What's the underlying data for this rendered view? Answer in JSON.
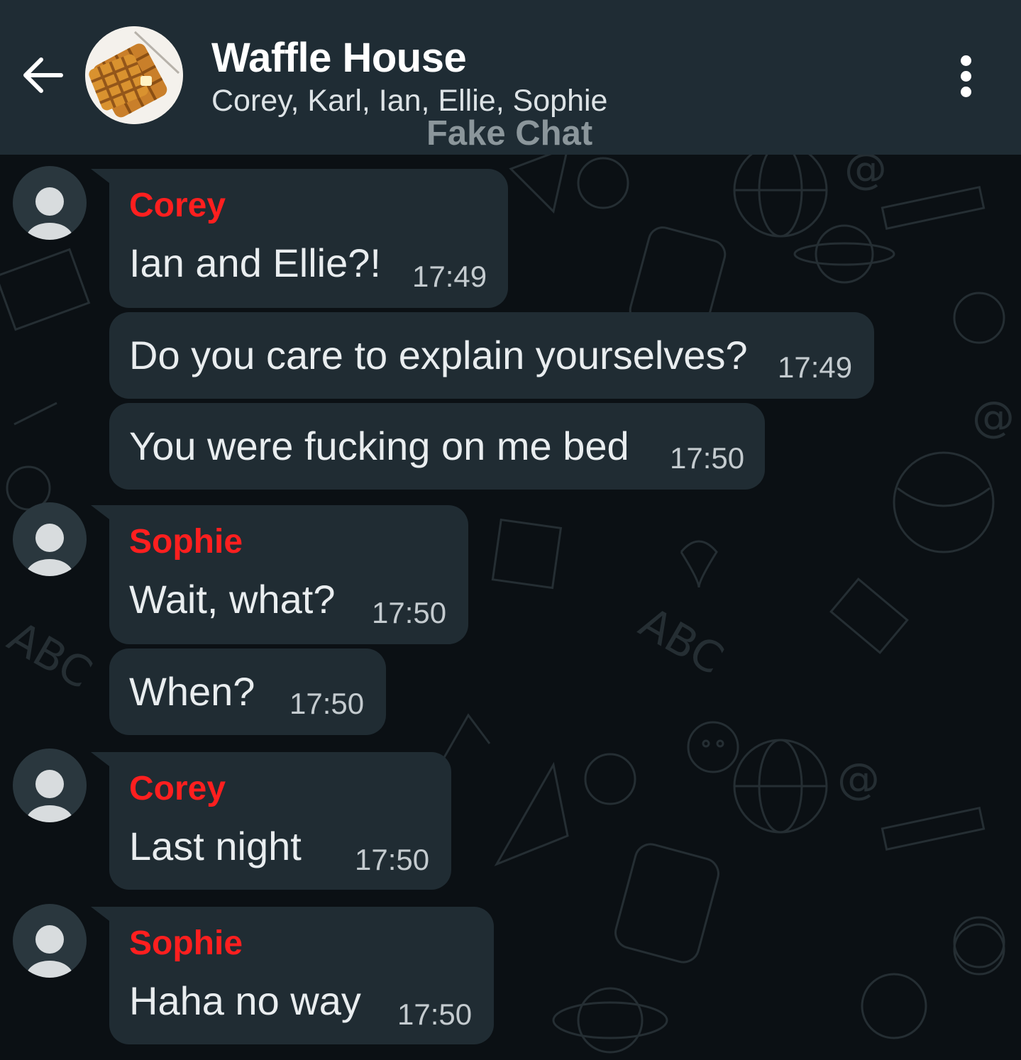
{
  "header": {
    "title": "Waffle House",
    "members": "Corey, Karl, Ian, Ellie, Sophie",
    "watermark": "Fake Chat"
  },
  "messages": [
    {
      "sender": "Corey",
      "text": "Ian and Ellie?!",
      "time": "17:49"
    },
    {
      "text": "Do you care to explain yourselves?",
      "time": "17:49"
    },
    {
      "text": "You were fucking on me bed",
      "time": "17:50"
    },
    {
      "sender": "Sophie",
      "text": "Wait, what?",
      "time": "17:50"
    },
    {
      "text": "When?",
      "time": "17:50"
    },
    {
      "sender": "Corey",
      "text": "Last night",
      "time": "17:50"
    },
    {
      "sender": "Sophie",
      "text": "Haha no way",
      "time": "17:50"
    }
  ],
  "colors": {
    "header_bg": "#1f2c34",
    "chat_bg": "#0b1014",
    "bubble_bg": "#202c33",
    "sender_name": "#ff1f1f"
  },
  "icons": {
    "back": "arrow-left-icon",
    "menu": "more-vertical-icon",
    "avatar": "person-placeholder-icon"
  }
}
